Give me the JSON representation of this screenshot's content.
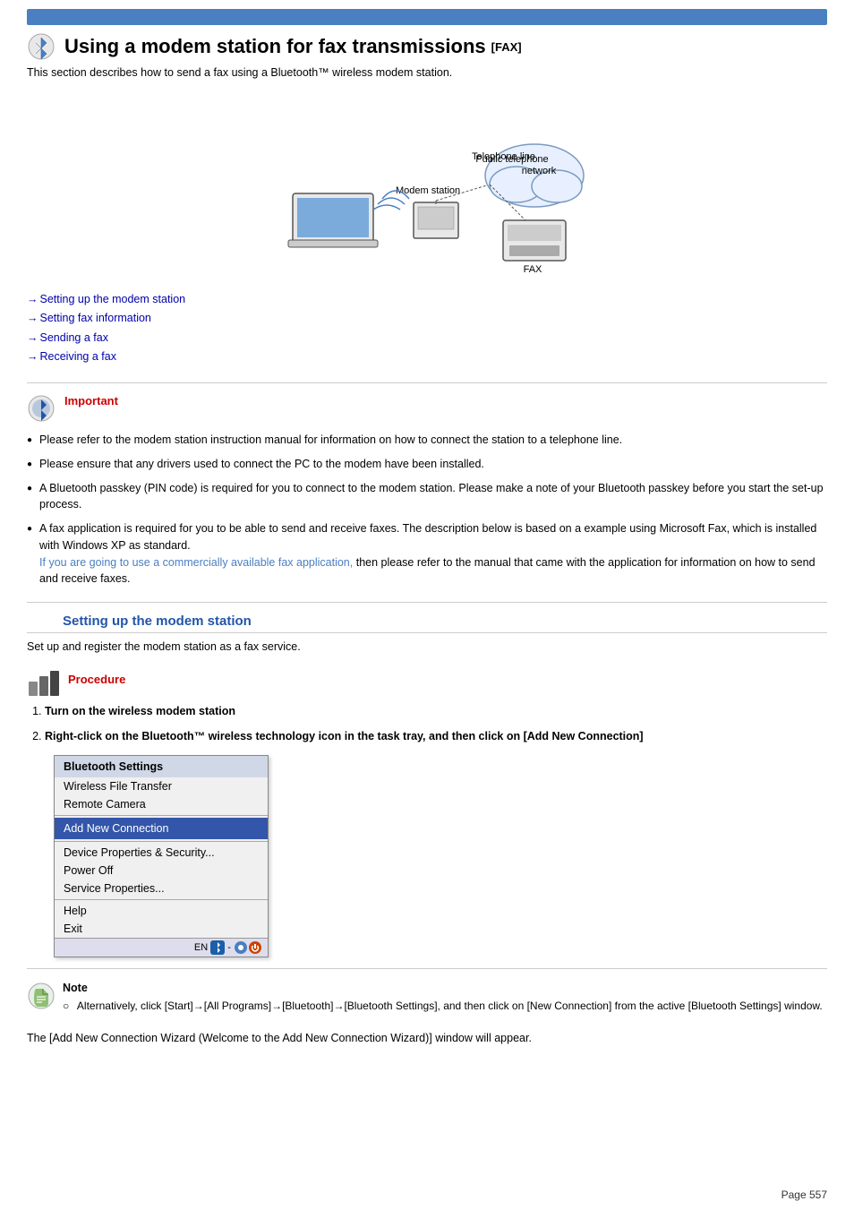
{
  "topbar": {},
  "page": {
    "title": "Using a modem station for fax transmissions",
    "title_badge": "[FAX]",
    "subtitle": "This section describes how to send a fax using a Bluetooth™ wireless modem station.",
    "diagram": {
      "labels": {
        "telephone_line": "Telephone line",
        "modem_station": "Modem station",
        "public_telephone": "Public telephone network",
        "fax": "FAX"
      }
    },
    "nav_links": [
      "Setting up the modem station",
      "Setting fax information",
      "Sending a fax",
      "Receiving a fax"
    ],
    "important": {
      "label": "Important",
      "bullets": [
        "Please refer to the modem station instruction manual for information on how to connect the station to a telephone line.",
        "Please ensure that any drivers used to connect the PC to the modem have been installed.",
        "A Bluetooth passkey (PIN code) is required for you to connect to the modem station. Please make a note of your Bluetooth passkey before you start the set-up process.",
        "A fax application is required for you to be able to send and receive faxes. The description below is based on a example using Microsoft Fax, which is installed with Windows XP as standard.",
        "If you are going to use a commercially available fax application, then please refer to the manual that came with the application for information on how to send and receive faxes."
      ],
      "fax_link_text": "If you are going to use a commercially available fax application,"
    }
  },
  "setting_section": {
    "heading": "Setting up the modem station",
    "description": "Set up and register the modem station as a fax service.",
    "procedure_label": "Procedure",
    "steps": [
      {
        "num": "1.",
        "text": "Turn on the wireless modem station"
      },
      {
        "num": "2.",
        "text": "Right-click on the Bluetooth™ wireless technology icon in the task tray, and then click on [Add New Connection]"
      }
    ]
  },
  "context_menu": {
    "header": "Bluetooth Settings",
    "items": [
      "Wireless File Transfer",
      "Remote Camera"
    ],
    "highlighted": "Add New Connection",
    "items2": [
      "Device Properties & Security...",
      "Power Off",
      "Service Properties..."
    ],
    "items3": [
      "Help",
      "Exit"
    ],
    "taskbar": "EN"
  },
  "note": {
    "label": "Note",
    "content": "Alternatively, click [Start]→[All Programs]→[Bluetooth]→[Bluetooth Settings], and then click on [New Connection] from the active [Bluetooth Settings] window."
  },
  "footer": {
    "wizard_text": "The [Add New Connection Wizard (Welcome to the Add New Connection Wizard)] window will appear.",
    "page_number": "Page 557"
  }
}
